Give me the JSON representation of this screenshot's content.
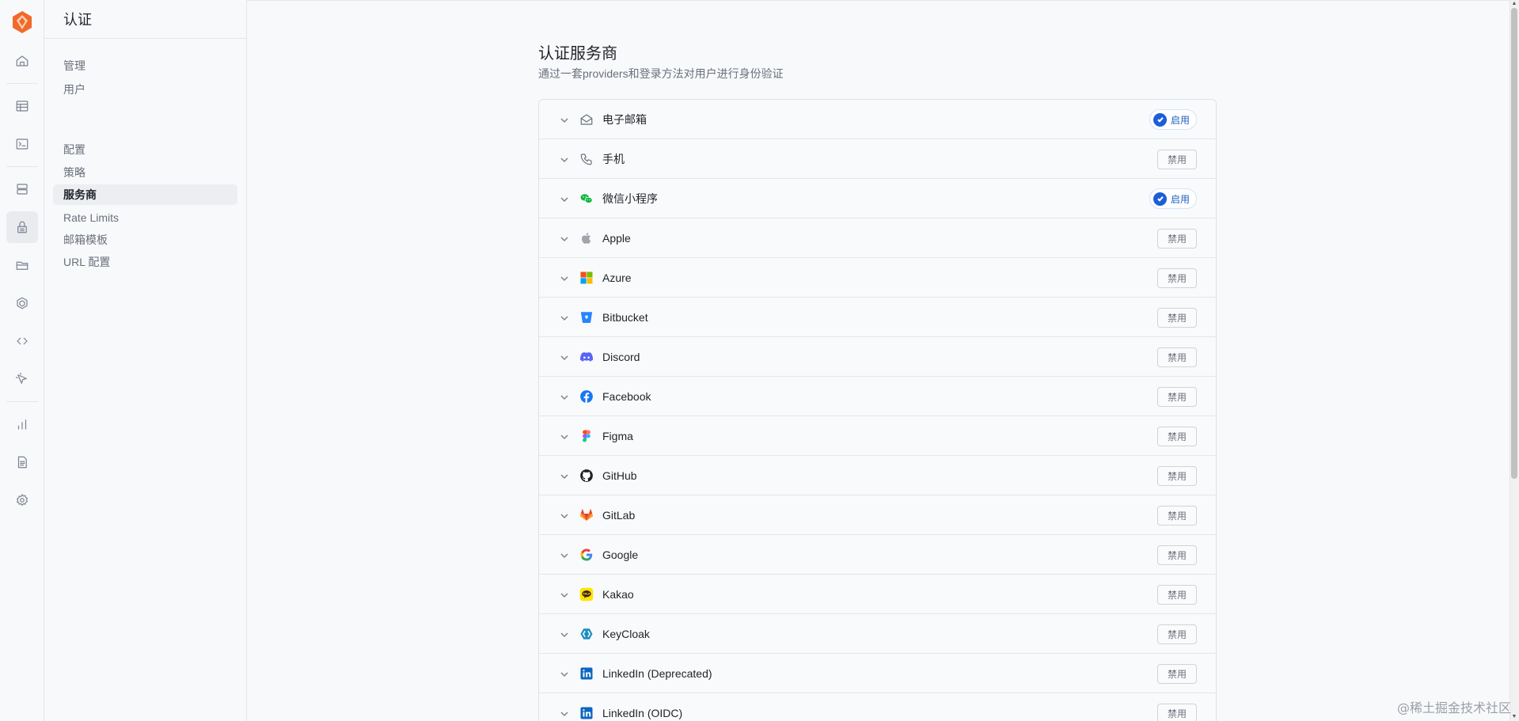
{
  "sidebar": {
    "title": "认证",
    "manage_heading": "管理",
    "users": "用户",
    "config_heading": "配置",
    "items": [
      {
        "label": "策略"
      },
      {
        "label": "服务商"
      },
      {
        "label": "Rate Limits"
      },
      {
        "label": "邮箱模板"
      },
      {
        "label": "URL 配置"
      }
    ]
  },
  "main": {
    "title": "认证服务商",
    "subtitle": "通过一套providers和登录方法对用户进行身份验证"
  },
  "status_labels": {
    "enabled": "启用",
    "disabled": "禁用"
  },
  "providers": [
    {
      "name": "电子邮箱",
      "icon": "mail-icon",
      "enabled": true,
      "status": "启用"
    },
    {
      "name": "手机",
      "icon": "phone-icon",
      "enabled": false,
      "status": "禁用"
    },
    {
      "name": "微信小程序",
      "icon": "wechat-icon",
      "enabled": true,
      "status": "启用"
    },
    {
      "name": "Apple",
      "icon": "apple-icon",
      "enabled": false,
      "status": "禁用"
    },
    {
      "name": "Azure",
      "icon": "azure-icon",
      "enabled": false,
      "status": "禁用"
    },
    {
      "name": "Bitbucket",
      "icon": "bitbucket-icon",
      "enabled": false,
      "status": "禁用"
    },
    {
      "name": "Discord",
      "icon": "discord-icon",
      "enabled": false,
      "status": "禁用"
    },
    {
      "name": "Facebook",
      "icon": "facebook-icon",
      "enabled": false,
      "status": "禁用"
    },
    {
      "name": "Figma",
      "icon": "figma-icon",
      "enabled": false,
      "status": "禁用"
    },
    {
      "name": "GitHub",
      "icon": "github-icon",
      "enabled": false,
      "status": "禁用"
    },
    {
      "name": "GitLab",
      "icon": "gitlab-icon",
      "enabled": false,
      "status": "禁用"
    },
    {
      "name": "Google",
      "icon": "google-icon",
      "enabled": false,
      "status": "禁用"
    },
    {
      "name": "Kakao",
      "icon": "kakao-icon",
      "enabled": false,
      "status": "禁用"
    },
    {
      "name": "KeyCloak",
      "icon": "keycloak-icon",
      "enabled": false,
      "status": "禁用"
    },
    {
      "name": "LinkedIn (Deprecated)",
      "icon": "linkedin-icon",
      "enabled": false,
      "status": "禁用"
    },
    {
      "name": "LinkedIn (OIDC)",
      "icon": "linkedin-icon",
      "enabled": false,
      "status": "禁用"
    }
  ],
  "watermark": "@稀土掘金技术社区",
  "colors": {
    "accent": "#1c5ed6",
    "logo": "#f06a2b"
  }
}
